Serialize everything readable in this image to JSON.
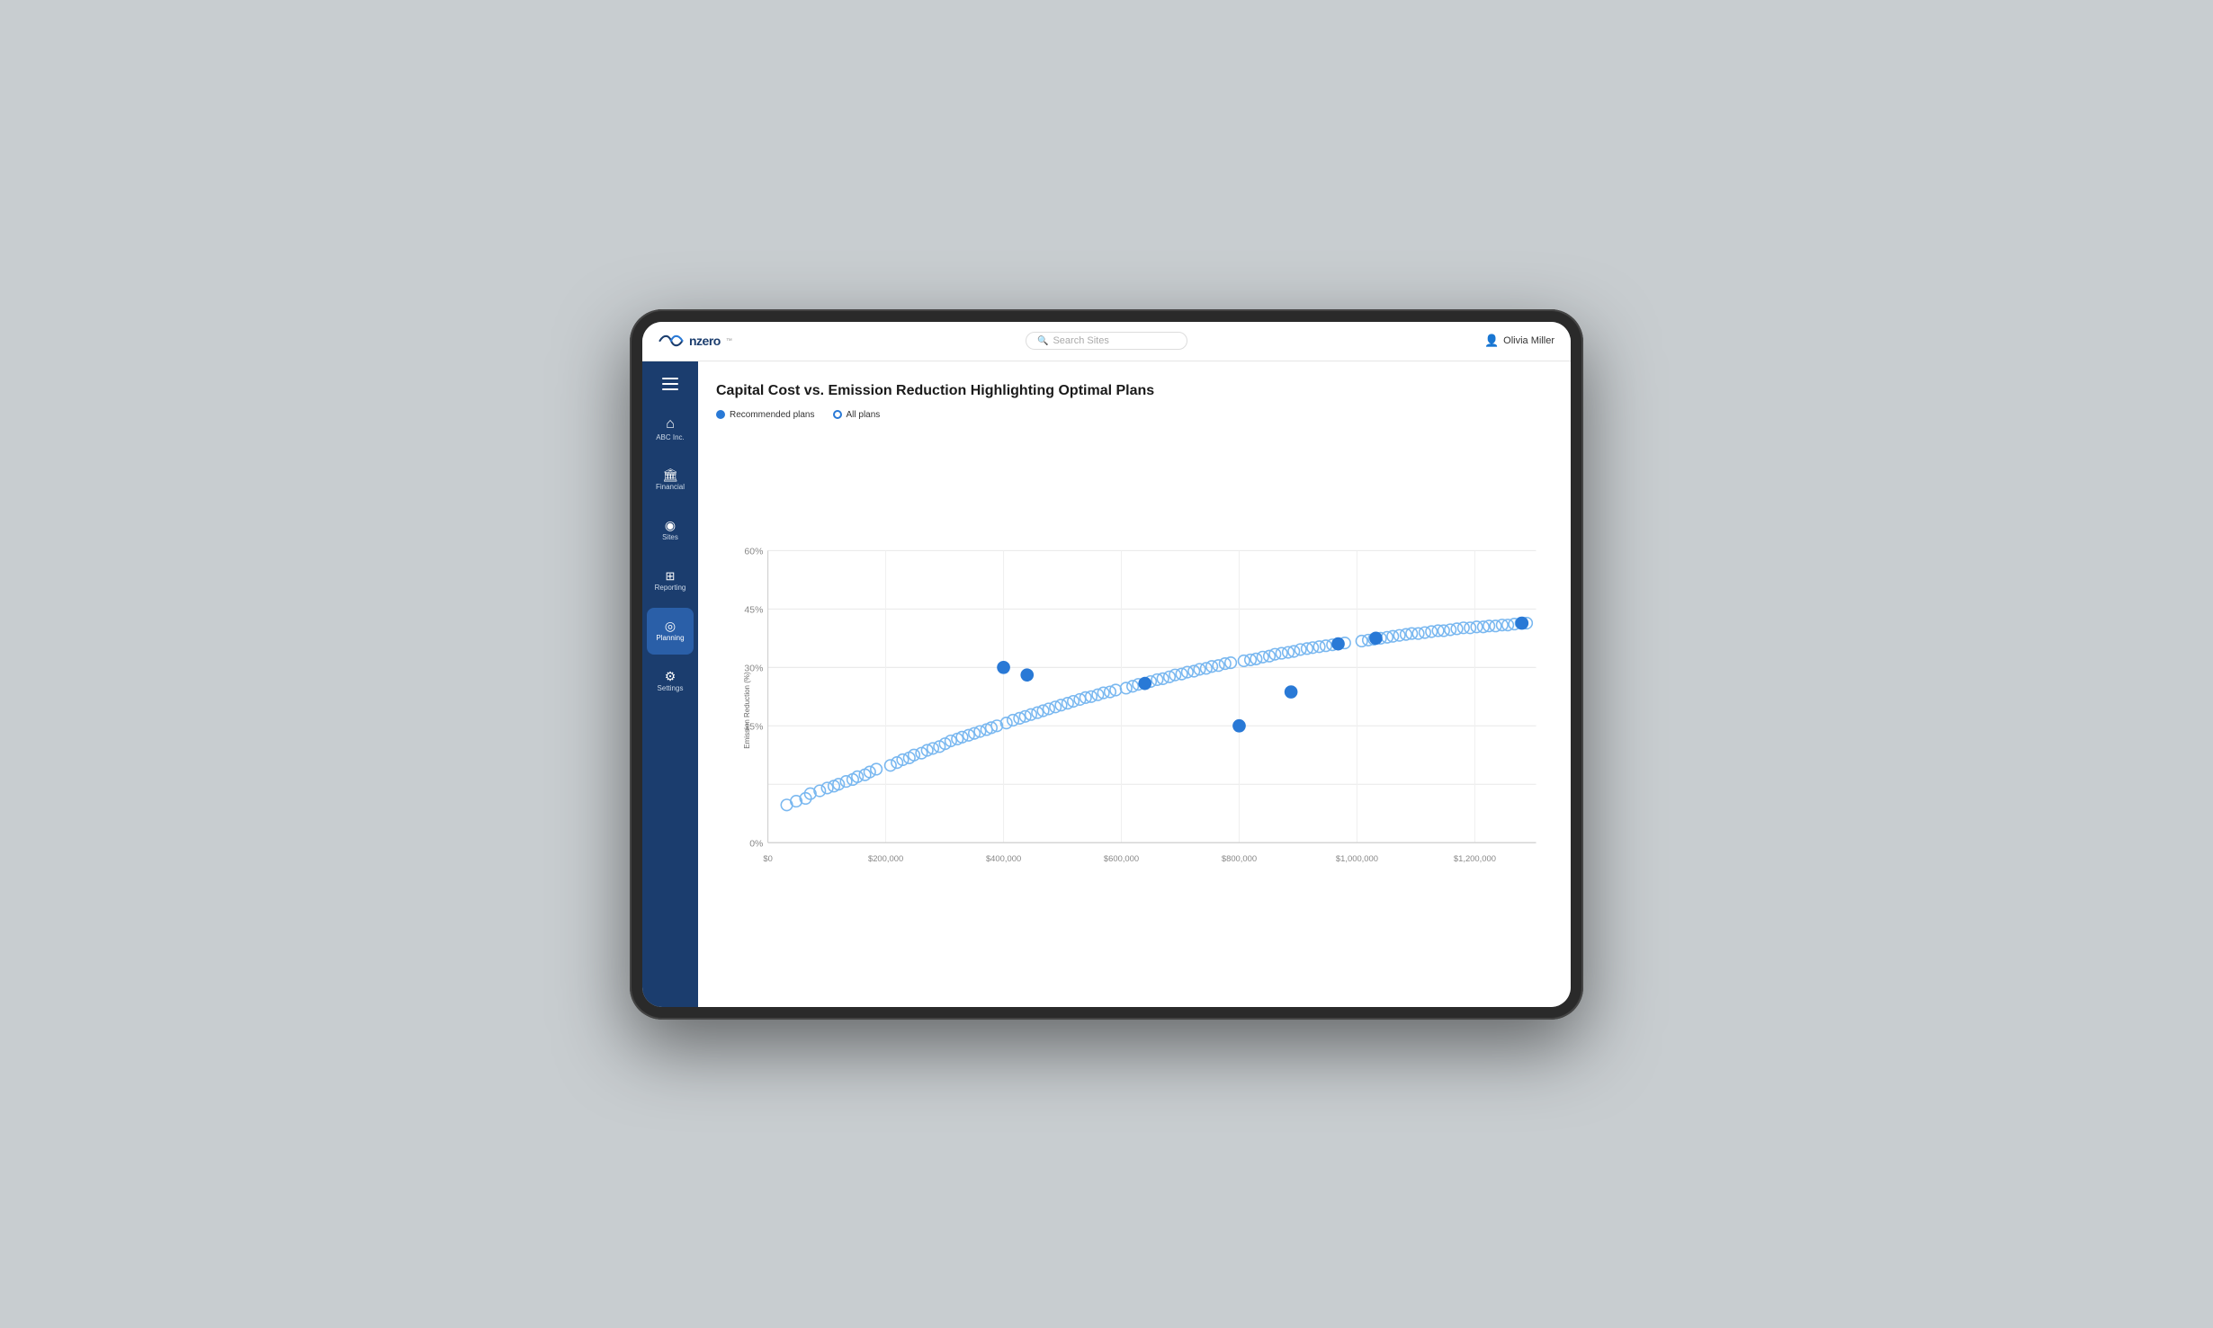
{
  "header": {
    "logo_text": "nzero",
    "search_placeholder": "Search Sites",
    "user_icon": "👤",
    "user_name": "Olivia Miller"
  },
  "sidebar": {
    "hamburger_label": "menu",
    "items": [
      {
        "id": "home",
        "icon": "🏠",
        "label": "ABC Inc.",
        "active": false
      },
      {
        "id": "financial",
        "icon": "🏛",
        "label": "Financial",
        "active": false
      },
      {
        "id": "sites",
        "icon": "📍",
        "label": "Sites",
        "active": false
      },
      {
        "id": "reporting",
        "icon": "⊞",
        "label": "Reporting",
        "active": false
      },
      {
        "id": "planning",
        "icon": "◎",
        "label": "Planning",
        "active": true
      },
      {
        "id": "settings",
        "icon": "⚙",
        "label": "Settings",
        "active": false
      }
    ]
  },
  "chart": {
    "title": "Capital Cost vs. Emission Reduction Highlighting Optimal Plans",
    "legend": {
      "recommended_label": "Recommended plans",
      "all_label": "All plans"
    },
    "y_axis": {
      "label": "Emission Reduction (%)",
      "ticks": [
        "0%",
        "15%",
        "30%",
        "45%",
        "60%"
      ]
    },
    "x_axis": {
      "ticks": [
        "$0",
        "$200,000",
        "$400,000",
        "$600,000",
        "$800,000",
        "$1,000,000",
        "$1,200,000"
      ]
    }
  }
}
